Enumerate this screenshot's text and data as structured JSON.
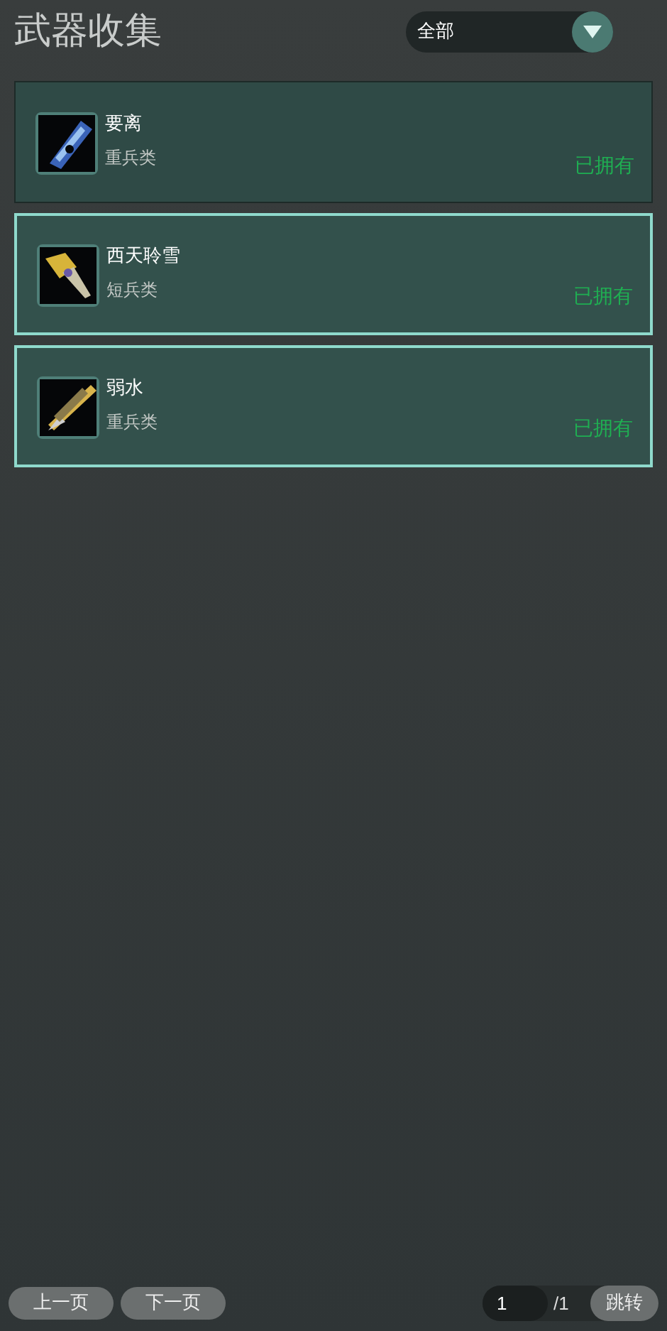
{
  "title": "武器收集",
  "filter": {
    "value": "全部"
  },
  "weapons": [
    {
      "name": "要离",
      "category": "重兵类",
      "status": "已拥有",
      "selected": false
    },
    {
      "name": "西天聆雪",
      "category": "短兵类",
      "status": "已拥有",
      "selected": true
    },
    {
      "name": "弱水",
      "category": "重兵类",
      "status": "已拥有",
      "selected": true
    }
  ],
  "pager": {
    "prev": "上一页",
    "next": "下一页",
    "page": "1",
    "total": "/1",
    "jump": "跳转"
  }
}
